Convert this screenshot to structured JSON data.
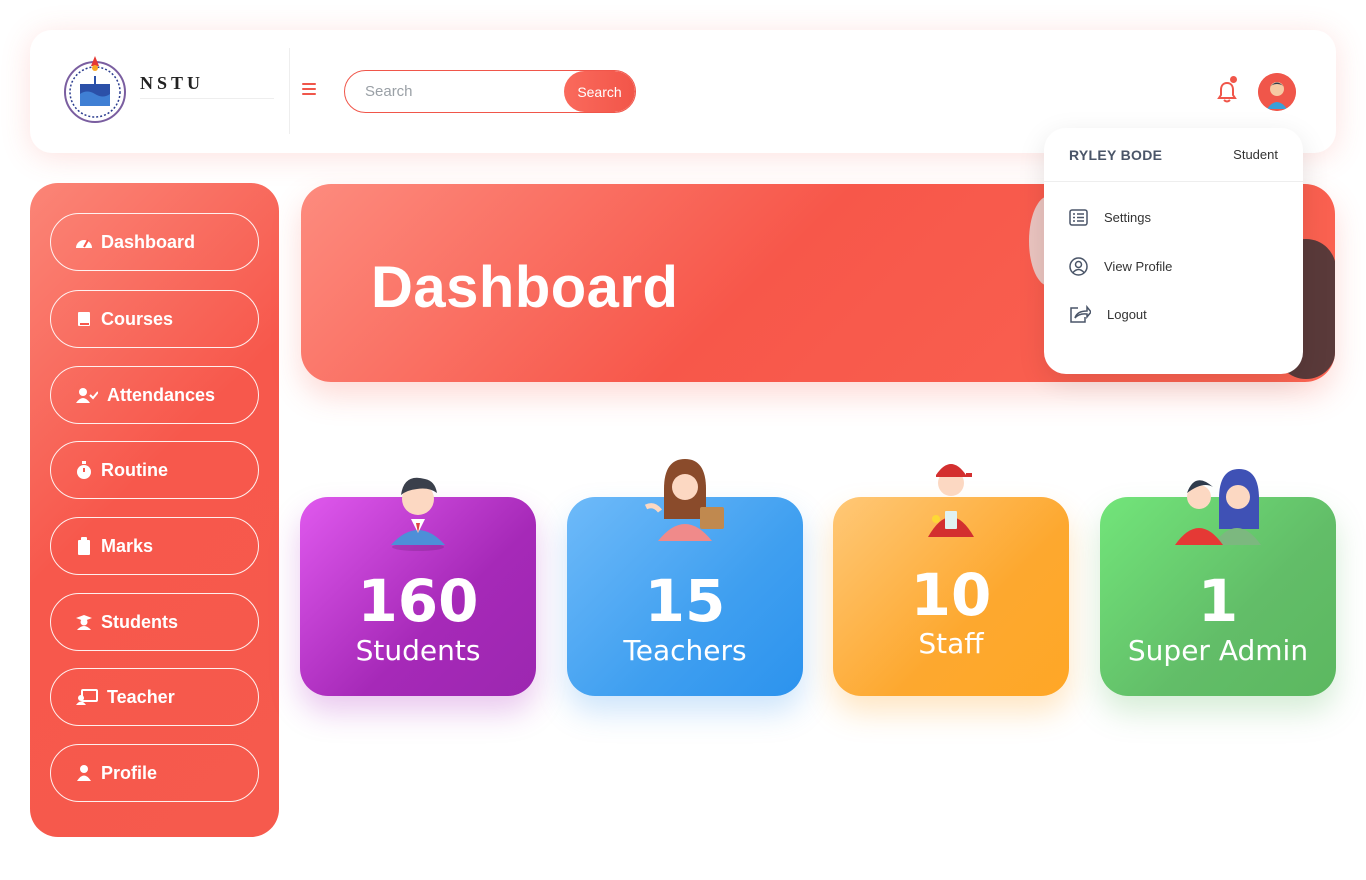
{
  "header": {
    "logo_text": "NSTU",
    "search_placeholder": "Search",
    "search_button": "Search"
  },
  "sidebar": {
    "items": [
      {
        "label": "Dashboard",
        "icon": "dashboard-icon"
      },
      {
        "label": "Courses",
        "icon": "book-icon"
      },
      {
        "label": "Attendances",
        "icon": "user-check-icon"
      },
      {
        "label": "Routine",
        "icon": "stopwatch-icon"
      },
      {
        "label": "Marks",
        "icon": "clipboard-icon"
      },
      {
        "label": "Students",
        "icon": "graduate-icon"
      },
      {
        "label": "Teacher",
        "icon": "chalkboard-teacher-icon"
      },
      {
        "label": "Profile",
        "icon": "user-icon"
      }
    ]
  },
  "banner": {
    "title": "Dashboard"
  },
  "profile_menu": {
    "name": "RYLEY BODE",
    "role": "Student",
    "items": [
      {
        "label": "Settings",
        "icon": "list-icon"
      },
      {
        "label": "View Profile",
        "icon": "user-circle-icon"
      },
      {
        "label": "Logout",
        "icon": "share-icon"
      }
    ]
  },
  "stats": [
    {
      "value": "160",
      "label": "Students",
      "color": "#c235c6"
    },
    {
      "value": "15",
      "label": "Teachers",
      "color": "#4aa9f3"
    },
    {
      "value": "10",
      "label": "Staff",
      "color": "#fdb44d"
    },
    {
      "value": "1",
      "label": "Super Admin",
      "color": "#67c56c"
    }
  ],
  "colors": {
    "accent": "#f7574a"
  }
}
